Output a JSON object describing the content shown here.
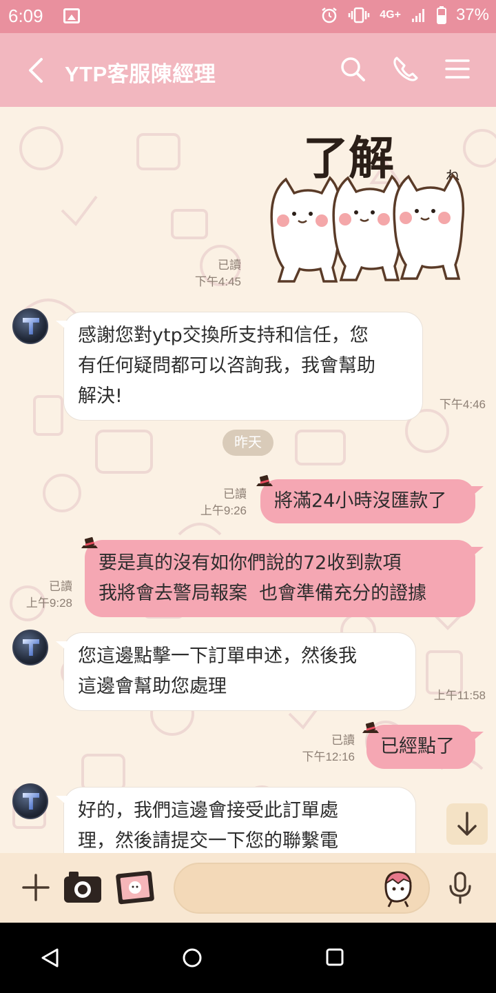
{
  "status_bar": {
    "time": "6:09",
    "network": "4G+",
    "battery": "37%"
  },
  "header": {
    "title": "YTP客服陳經理"
  },
  "chat": {
    "sticker": {
      "text": "了解",
      "small_text": "ね"
    },
    "date_divider": "昨天",
    "messages": [
      {
        "dir": "out",
        "type": "sticker",
        "read": "已讀",
        "time": "下午4:45"
      },
      {
        "dir": "in",
        "lines": [
          "感謝您對ytp交換所支持和信任，您",
          "有任何疑問都可以咨詢我，我會幫助",
          "解決!"
        ],
        "time": "下午4:46"
      },
      {
        "dir": "out",
        "lines": [
          "將滿24小時沒匯款了"
        ],
        "read": "已讀",
        "time": "上午9:26"
      },
      {
        "dir": "out",
        "lines": [
          "要是真的沒有如你們說的72收到款項",
          "我將會去警局報案  也會準備充分的證據"
        ],
        "read": "已讀",
        "time": "上午9:28"
      },
      {
        "dir": "in",
        "lines": [
          "您這邊點擊一下訂單申述，然後我",
          "這邊會幫助您處理"
        ],
        "time": "上午11:58"
      },
      {
        "dir": "out",
        "lines": [
          "已經點了"
        ],
        "read": "已讀",
        "time": "下午12:16"
      },
      {
        "dir": "in",
        "lines": [
          "好的，我們這邊會接受此訂單處",
          "理，然後請提交一下您的聯繫電"
        ]
      }
    ]
  },
  "colors": {
    "accent": "#f2b7bf",
    "status": "#e9909e",
    "bubble_out": "#f5a7b3",
    "bubble_in": "#ffffff",
    "chat_bg": "#fbf1e4"
  },
  "icons": [
    "back-arrow-icon",
    "search-icon",
    "phone-icon",
    "menu-icon",
    "plus-icon",
    "camera-icon",
    "photo-icon",
    "sticker-icon",
    "mic-icon",
    "arrow-down-icon"
  ]
}
